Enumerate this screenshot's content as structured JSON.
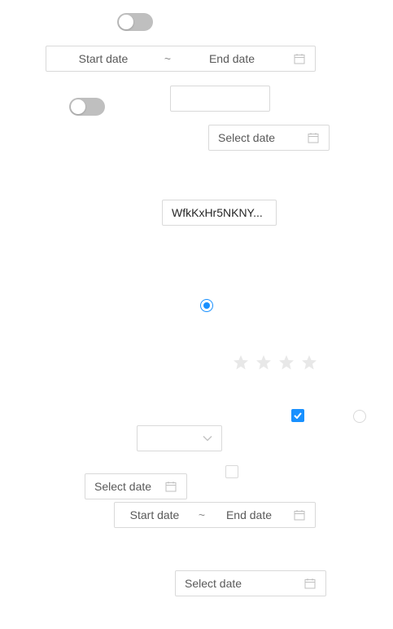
{
  "switch_1": {
    "checked": false
  },
  "range_picker_1": {
    "start_placeholder": "Start date",
    "separator": "~",
    "end_placeholder": "End date",
    "icon": "calendar-icon"
  },
  "switch_2": {
    "checked": false
  },
  "empty_input": {
    "value": ""
  },
  "date_picker_1": {
    "placeholder": "Select date",
    "icon": "calendar-icon"
  },
  "text_input": {
    "value": "WfkKxHr5NKNY..."
  },
  "radio_1": {
    "checked": true
  },
  "rate": {
    "value": 0,
    "count": 4
  },
  "checkbox_1": {
    "checked": true
  },
  "radio_2": {
    "checked": false
  },
  "select": {
    "value": "",
    "icon": "chevron-down-icon"
  },
  "checkbox_2": {
    "checked": false
  },
  "date_picker_2": {
    "placeholder": "Select date",
    "icon": "calendar-icon"
  },
  "range_picker_2": {
    "start_placeholder": "Start date",
    "separator": "~",
    "end_placeholder": "End date",
    "icon": "calendar-icon"
  },
  "date_picker_3": {
    "placeholder": "Select date",
    "icon": "calendar-icon"
  },
  "colors": {
    "primary": "#1890ff",
    "border": "#d9d9d9",
    "switch_off": "#bfbfbf",
    "star_empty": "#e8e8e8",
    "placeholder": "#595959"
  }
}
